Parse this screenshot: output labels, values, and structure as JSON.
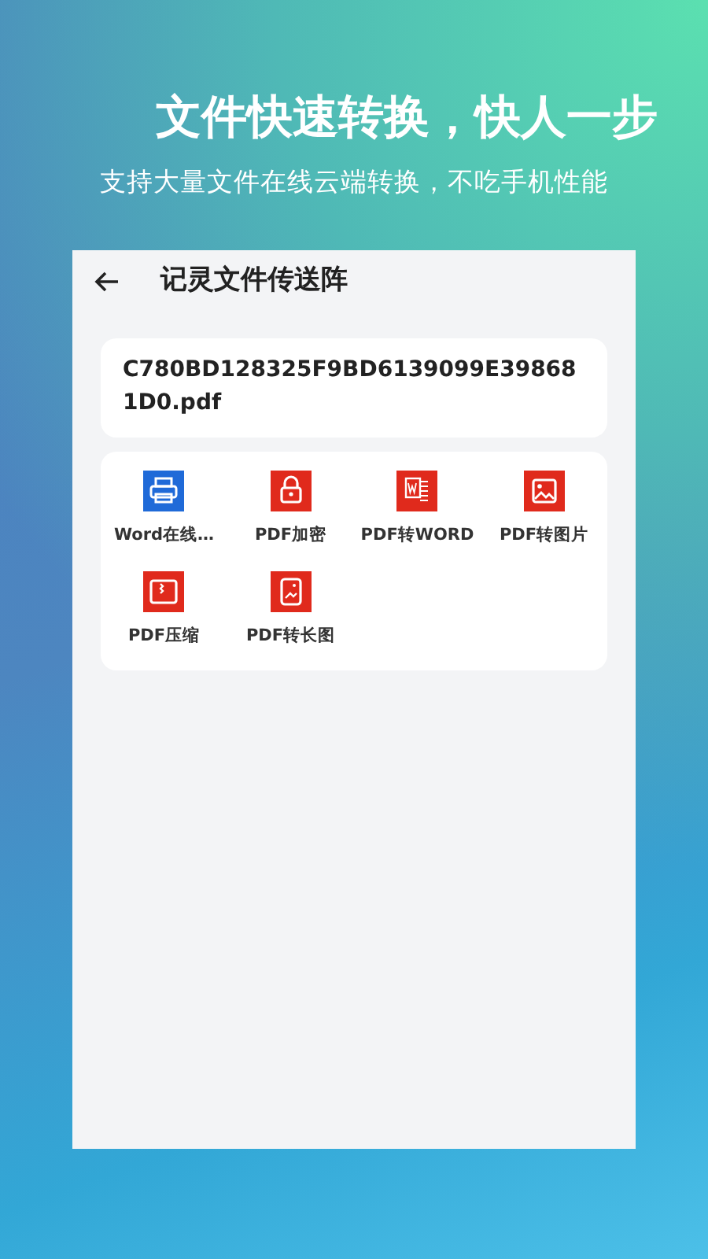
{
  "headline": "文件快速转换，快人一步",
  "subtitle": "支持大量文件在线云端转换，不吃手机性能",
  "app": {
    "title": "记灵文件传送阵",
    "file_name": "C780BD128325F9BD6139099E398681D0.pdf",
    "tools": [
      {
        "label": "Word在线…",
        "kind": "printer",
        "color": "#1f6ad8"
      },
      {
        "label": "PDF加密",
        "kind": "lock",
        "color": "#e02a1c"
      },
      {
        "label": "PDF转WORD",
        "kind": "word",
        "color": "#e02a1c"
      },
      {
        "label": "PDF转图片",
        "kind": "image",
        "color": "#e02a1c"
      },
      {
        "label": "PDF压缩",
        "kind": "zip",
        "color": "#e02a1c"
      },
      {
        "label": "PDF转长图",
        "kind": "longimage",
        "color": "#e02a1c"
      }
    ]
  }
}
